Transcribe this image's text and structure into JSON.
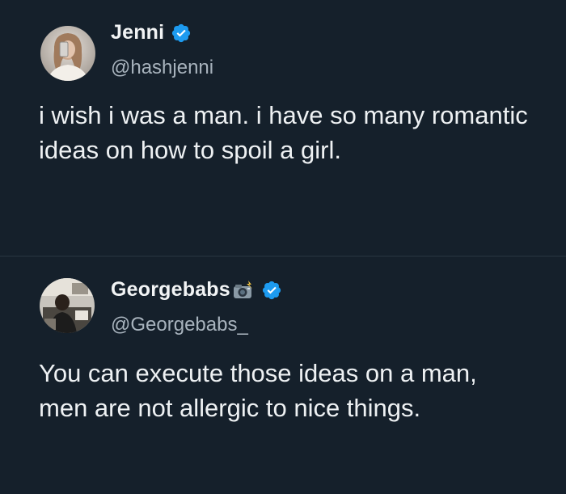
{
  "tweets": [
    {
      "author": {
        "display_name": "Jenni",
        "handle": "@hashjenni",
        "verified": true,
        "avatar_icon": "avatar-photo-icon"
      },
      "text": "i wish i was a man. i have so many romantic ideas on how to spoil a girl."
    },
    {
      "author": {
        "display_name": "Georgebabs",
        "name_emoji": "camera-with-flash-icon",
        "handle": "@Georgebabs_",
        "verified": true,
        "avatar_icon": "avatar-photo-icon"
      },
      "text": "You can execute those ideas on a man, men are not allergic to nice things."
    }
  ],
  "colors": {
    "background": "#15202b",
    "text": "#e7e9ea",
    "secondary_text": "#a8b3bd",
    "verified_blue": "#1d9bf0"
  }
}
